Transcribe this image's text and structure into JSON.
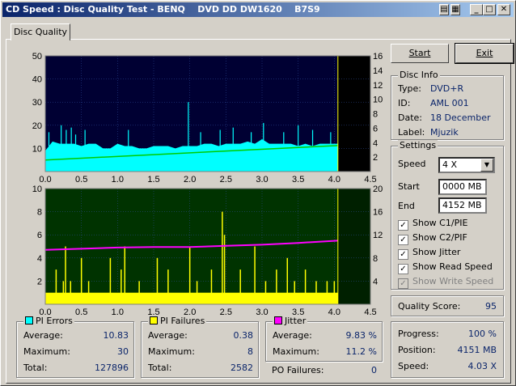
{
  "window": {
    "title": "CD Speed : Disc Quality Test - BENQ    DVD DD DW1620    B7S9",
    "controls": [
      "minimize-icon",
      "maximize-icon",
      "close-icon"
    ]
  },
  "tab": {
    "label": "Disc Quality"
  },
  "buttons": {
    "start": "Start",
    "exit": "Exit"
  },
  "disc_info": {
    "title": "Disc Info",
    "rows": [
      {
        "label": "Type:",
        "value": "DVD+R"
      },
      {
        "label": "ID:",
        "value": "AML 001"
      },
      {
        "label": "Date:",
        "value": "18 December"
      },
      {
        "label": "Label:",
        "value": "Mjuzik"
      }
    ]
  },
  "settings": {
    "title": "Settings",
    "speed_label": "Speed",
    "speed_value": "4 X",
    "start_label": "Start",
    "start_value": "0000 MB",
    "end_label": "End",
    "end_value": "4152 MB",
    "checks": [
      {
        "label": "Show C1/PIE",
        "checked": true,
        "enabled": true
      },
      {
        "label": "Show C2/PIF",
        "checked": true,
        "enabled": true
      },
      {
        "label": "Show Jitter",
        "checked": true,
        "enabled": true
      },
      {
        "label": "Show Read Speed",
        "checked": true,
        "enabled": true
      },
      {
        "label": "Show Write Speed",
        "checked": true,
        "enabled": false
      }
    ]
  },
  "quality": {
    "label": "Quality Score:",
    "value": "95"
  },
  "progress": {
    "rows": [
      {
        "label": "Progress:",
        "value": "100 %"
      },
      {
        "label": "Position:",
        "value": "4151 MB"
      },
      {
        "label": "Speed:",
        "value": "4.03 X"
      }
    ]
  },
  "pi_errors": {
    "title": "PI Errors",
    "color": "#00ffff",
    "rows": [
      {
        "label": "Average:",
        "value": "10.83"
      },
      {
        "label": "Maximum:",
        "value": "30"
      },
      {
        "label": "Total:",
        "value": "127896"
      }
    ]
  },
  "pi_failures": {
    "title": "PI Failures",
    "color": "#ffff00",
    "rows": [
      {
        "label": "Average:",
        "value": "0.38"
      },
      {
        "label": "Maximum:",
        "value": "8"
      },
      {
        "label": "Total:",
        "value": "2582"
      }
    ]
  },
  "jitter": {
    "title": "Jitter",
    "color": "#ff00ff",
    "rows": [
      {
        "label": "Average:",
        "value": "9.83 %"
      },
      {
        "label": "Maximum:",
        "value": "11.2 %"
      }
    ]
  },
  "po_failures": {
    "label": "PO Failures:",
    "value": "0"
  },
  "chart_data": [
    {
      "type": "area",
      "x_ticks": [
        "0.0",
        "0.5",
        "1.0",
        "1.5",
        "2.0",
        "2.5",
        "3.0",
        "3.5",
        "4.0",
        "4.5"
      ],
      "y_left_ticks": [
        "10",
        "20",
        "30",
        "40",
        "50"
      ],
      "y_right_ticks": [
        "2",
        "4",
        "6",
        "8",
        "10",
        "12",
        "14",
        "16"
      ],
      "xlim": [
        0,
        4.5
      ],
      "ylim_left": [
        0,
        50
      ],
      "ylim_right": [
        0,
        16
      ],
      "background": "#000033",
      "series": [
        {
          "name": "PI Errors",
          "color": "#00ffff",
          "axis": "left",
          "x": [
            0.0,
            0.1,
            0.2,
            0.3,
            0.4,
            0.5,
            0.6,
            0.7,
            0.8,
            0.9,
            1.0,
            1.1,
            1.2,
            1.3,
            1.4,
            1.5,
            1.6,
            1.7,
            1.8,
            1.9,
            2.0,
            2.1,
            2.2,
            2.3,
            2.4,
            2.5,
            2.6,
            2.7,
            2.8,
            2.9,
            3.0,
            3.1,
            3.2,
            3.3,
            3.4,
            3.5,
            3.6,
            3.7,
            3.8,
            3.9,
            4.05
          ],
          "y": [
            9,
            13,
            12,
            12,
            12,
            11,
            12,
            12,
            10,
            10,
            12,
            11,
            11,
            10,
            10,
            11,
            11,
            11,
            10,
            11,
            11,
            11,
            12,
            12,
            11,
            12,
            12,
            12,
            13,
            12,
            14,
            12,
            12,
            12,
            12,
            11,
            12,
            11,
            12,
            12,
            12
          ],
          "peaks_x": [
            0.05,
            0.22,
            0.29,
            0.36,
            0.42,
            0.55,
            1.15,
            1.98,
            2.15,
            2.42,
            2.6,
            2.85,
            3.02,
            3.3,
            3.5,
            3.7,
            3.95
          ],
          "peaks_y": [
            17,
            20,
            18,
            19,
            16,
            18,
            18,
            30,
            17,
            18,
            19,
            17,
            21,
            17,
            20,
            18,
            17
          ]
        },
        {
          "name": "Read Speed",
          "color": "#00cc00",
          "axis": "right",
          "x": [
            0.0,
            4.05
          ],
          "y": [
            1.6,
            3.6
          ]
        }
      ]
    },
    {
      "type": "bar",
      "x_ticks": [
        "0.0",
        "0.5",
        "1.0",
        "1.5",
        "2.0",
        "2.5",
        "3.0",
        "3.5",
        "4.0",
        "4.5"
      ],
      "y_left_ticks": [
        "2",
        "4",
        "6",
        "8",
        "10"
      ],
      "y_right_ticks": [
        "4",
        "8",
        "12",
        "16",
        "20"
      ],
      "xlim": [
        0,
        4.5
      ],
      "ylim_left": [
        0,
        10
      ],
      "ylim_right": [
        0,
        20
      ],
      "background": "#003300",
      "series": [
        {
          "name": "PI Failures",
          "color": "#ffff00",
          "axis": "left",
          "baseline": 1,
          "spikes_x": [
            0.15,
            0.25,
            0.28,
            0.35,
            0.5,
            0.6,
            0.9,
            1.05,
            1.1,
            1.3,
            1.55,
            1.7,
            2.0,
            2.1,
            2.3,
            2.45,
            2.48,
            2.7,
            2.9,
            3.05,
            3.2,
            3.35,
            3.45,
            3.6,
            3.75,
            3.9,
            4.0
          ],
          "spikes_y": [
            3,
            2,
            5,
            2,
            4,
            2,
            4,
            3,
            5,
            2,
            4,
            3,
            5,
            2,
            3,
            8,
            6,
            3,
            5,
            2,
            3,
            4,
            2,
            3,
            2,
            2,
            2
          ]
        },
        {
          "name": "Jitter",
          "color": "#ff00ff",
          "axis": "right",
          "x": [
            0.0,
            0.5,
            1.0,
            1.5,
            2.0,
            2.5,
            3.0,
            3.5,
            4.05
          ],
          "y": [
            9.4,
            9.6,
            9.8,
            9.9,
            9.9,
            10.1,
            10.3,
            10.6,
            11.0
          ]
        }
      ]
    }
  ]
}
